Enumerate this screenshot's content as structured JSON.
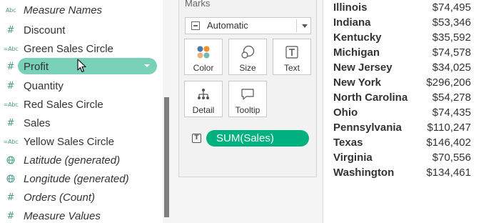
{
  "data_pane": {
    "fields": [
      {
        "label": "Measure Names",
        "type": "abc",
        "icon": "abc-icon",
        "italic": true
      },
      {
        "label": "Discount",
        "type": "hash",
        "icon": "hash-icon",
        "italic": false
      },
      {
        "label": "Green Sales Circle",
        "type": "calc-abc",
        "icon": "calc-abc-icon",
        "italic": false
      },
      {
        "label": "Profit",
        "type": "hash",
        "icon": "hash-icon",
        "italic": false,
        "selected": true
      },
      {
        "label": "Quantity",
        "type": "hash",
        "icon": "hash-icon",
        "italic": false
      },
      {
        "label": "Red Sales Circle",
        "type": "calc-abc",
        "icon": "calc-abc-icon",
        "italic": false
      },
      {
        "label": "Sales",
        "type": "hash",
        "icon": "hash-icon",
        "italic": false
      },
      {
        "label": "Yellow Sales Circle",
        "type": "calc-abc",
        "icon": "calc-abc-icon",
        "italic": false
      },
      {
        "label": "Latitude (generated)",
        "type": "globe",
        "icon": "globe-icon",
        "italic": true
      },
      {
        "label": "Longitude (generated)",
        "type": "globe",
        "icon": "globe-icon",
        "italic": true
      },
      {
        "label": "Orders (Count)",
        "type": "hash",
        "icon": "hash-icon",
        "italic": true
      },
      {
        "label": "Measure Values",
        "type": "hash",
        "icon": "hash-icon",
        "italic": true
      }
    ]
  },
  "marks": {
    "title": "Marks",
    "mark_type": "Automatic",
    "buttons": {
      "color": "Color",
      "size": "Size",
      "text": "Text",
      "detail": "Detail",
      "tooltip": "Tooltip"
    },
    "shelf_pill": "SUM(Sales)"
  },
  "table": {
    "rows": [
      {
        "state": "Illinois",
        "sales": "$74,495"
      },
      {
        "state": "Indiana",
        "sales": "$53,346"
      },
      {
        "state": "Kentucky",
        "sales": "$35,592"
      },
      {
        "state": "Michigan",
        "sales": "$74,578"
      },
      {
        "state": "New Jersey",
        "sales": "$34,025"
      },
      {
        "state": "New York",
        "sales": "$296,206"
      },
      {
        "state": "North Carolina",
        "sales": "$54,278"
      },
      {
        "state": "Ohio",
        "sales": "$74,435"
      },
      {
        "state": "Pennsylvania",
        "sales": "$110,247"
      },
      {
        "state": "Texas",
        "sales": "$146,402"
      },
      {
        "state": "Virginia",
        "sales": "$70,556"
      },
      {
        "state": "Washington",
        "sales": "$134,461"
      }
    ]
  },
  "colors": {
    "field_icon": "#4a9a8a",
    "selected_pill": "#79d1b7",
    "sum_pill": "#00b180"
  }
}
